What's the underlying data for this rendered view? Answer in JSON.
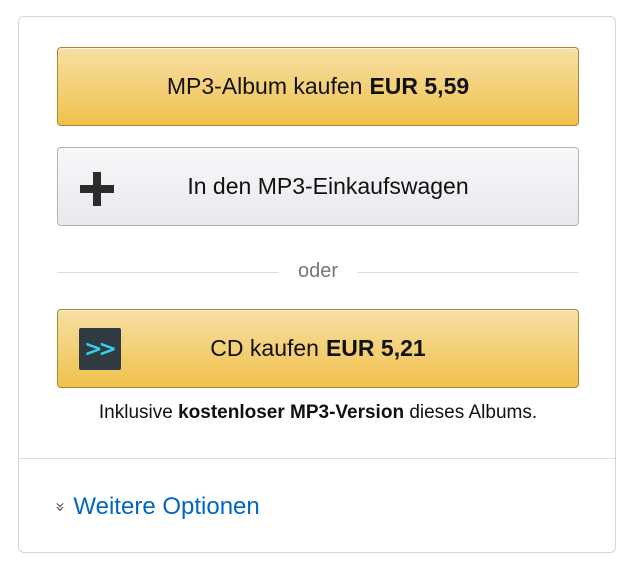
{
  "buy_mp3": {
    "label": "MP3-Album kaufen",
    "price": "EUR 5,59"
  },
  "add_to_cart": {
    "label": "In den MP3-Einkaufswagen",
    "icon": "plus-icon"
  },
  "divider": {
    "text": "oder"
  },
  "buy_cd": {
    "label": "CD kaufen",
    "price": "EUR 5,21",
    "icon": "autorip-icon"
  },
  "note": {
    "prefix": "Inklusive",
    "bold": "kostenloser MP3-Version",
    "suffix": "dieses Albums."
  },
  "more_options": {
    "label": "Weitere Optionen",
    "icon": "chevron-double-down-icon"
  },
  "colors": {
    "button_yellow": "#f0c14b",
    "link": "#0066c0",
    "autorip_bg": "#2f3b40",
    "autorip_arrows": "#33d0f0"
  }
}
